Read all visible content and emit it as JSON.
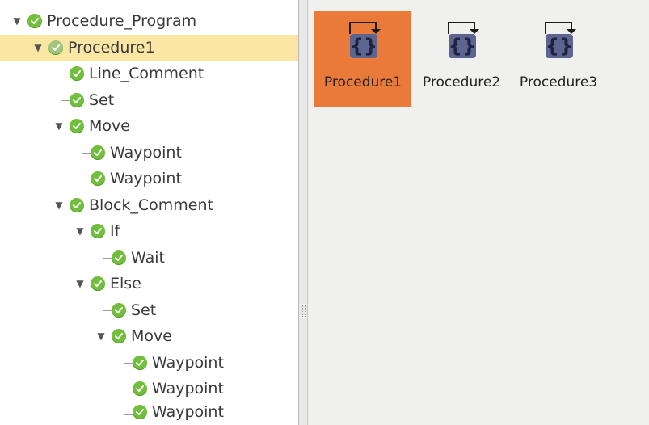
{
  "tree": {
    "rows": [
      {
        "label": "Procedure_Program",
        "expanded": true,
        "selected": false
      },
      {
        "label": "Procedure1",
        "expanded": true,
        "selected": true
      },
      {
        "label": "Line_Comment",
        "expanded": null,
        "selected": false
      },
      {
        "label": "Set",
        "expanded": null,
        "selected": false
      },
      {
        "label": "Move",
        "expanded": true,
        "selected": false
      },
      {
        "label": "Waypoint",
        "expanded": null,
        "selected": false
      },
      {
        "label": "Waypoint",
        "expanded": null,
        "selected": false
      },
      {
        "label": "Block_Comment",
        "expanded": true,
        "selected": false
      },
      {
        "label": "If",
        "expanded": true,
        "selected": false
      },
      {
        "label": "Wait",
        "expanded": null,
        "selected": false
      },
      {
        "label": "Else",
        "expanded": true,
        "selected": false
      },
      {
        "label": "Set",
        "expanded": null,
        "selected": false
      },
      {
        "label": "Move",
        "expanded": true,
        "selected": false
      },
      {
        "label": "Waypoint",
        "expanded": null,
        "selected": false
      },
      {
        "label": "Waypoint",
        "expanded": null,
        "selected": false
      },
      {
        "label": "Waypoint",
        "expanded": null,
        "selected": false
      }
    ]
  },
  "procedures": [
    {
      "label": "Procedure1",
      "active": true
    },
    {
      "label": "Procedure2",
      "active": false
    },
    {
      "label": "Procedure3",
      "active": false
    }
  ],
  "colors": {
    "selected_row": "#fbe6a3",
    "active_tile": "#ea7a3a",
    "check_green": "#72be3d"
  },
  "icons": {
    "expand": "triangle-down-icon",
    "status": "check-circle-icon",
    "procedure": "procedure-braces-icon"
  }
}
